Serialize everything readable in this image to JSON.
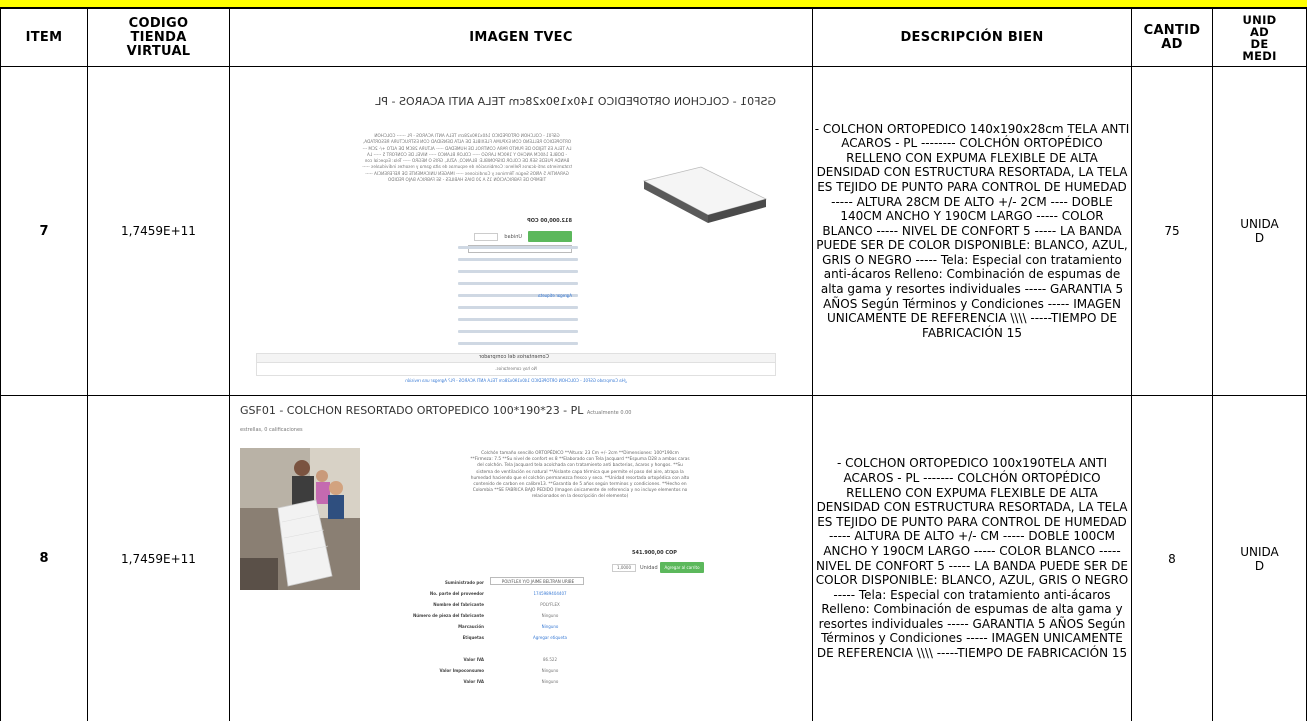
{
  "headers": {
    "item": "ITEM",
    "codigo_line1": "CODIGO",
    "codigo_line2": "TIENDA",
    "codigo_line3": "VIRTUAL",
    "imagen": "IMAGEN TVEC",
    "descripcion": "DESCRIPCIÓN BIEN",
    "cantidad_line1": "CANTID",
    "cantidad_line2": "AD",
    "unidad_line1": "UNID",
    "unidad_line2": "AD",
    "unidad_line3": "DE",
    "unidad_line4": "MEDI"
  },
  "rows": [
    {
      "item": "7",
      "codigo": "1,7459E+11",
      "descripcion": "- COLCHON ORTOPEDICO 140x190x28cm TELA ANTI ACAROS - PL -------- COLCHÓN ORTOPÉDICO RELLENO CON EXPUMA FLEXIBLE DE ALTA DENSIDAD CON ESTRUCTURA RESORTADA, LA TELA ES TEJIDO DE PUNTO PARA CONTROL DE HUMEDAD ----- ALTURA 28CM DE ALTO +/- 2CM ---- DOBLE 140CM ANCHO Y 190CM LARGO ----- COLOR BLANCO ----- NIVEL DE CONFORT 5 ----- LA BANDA PUEDE SER DE COLOR DISPONIBLE: BLANCO, AZUL, GRIS O NEGRO ----- Tela: Especial con tratamiento anti-ácaros Relleno: Combinación de espumas de alta gama y resortes individuales ----- GARANTIA 5 AÑOS Según Términos y Condiciones ----- IMAGEN UNICAMENTE DE REFERENCIA \\\\\\\\ -----TIEMPO DE FABRICACIÓN 15",
      "cantidad": "75",
      "unidad_line1": "UNIDA",
      "unidad_line2": "D",
      "image": {
        "title": "GSF01 - COLCHON ORTOPEDICO 140x190x28cm TELA ANTI ACAROS - PL",
        "price": "812.000,00 COP",
        "unit_label": "Unidad",
        "comments_title": "Comentarios del comprador",
        "comments_body": "No hay comentarios.",
        "footer": "¿Ha Comprado GSF01 - COLCHON ORTOPEDICO 140x190x28cm TELA ANTI ACAROS - PL? Agregar una revisión",
        "tag_label": "Agregar etiqueta"
      }
    },
    {
      "item": "8",
      "codigo": "1,7459E+11",
      "descripcion": "- COLCHON ORTOPEDICO 100x190TELA ANTI ACAROS - PL ------- COLCHÓN ORTOPÉDICO RELLENO CON EXPUMA FLEXIBLE DE ALTA DENSIDAD CON ESTRUCTURA RESORTADA, LA TELA ES TEJIDO DE PUNTO PARA CONTROL DE HUMEDAD ----- ALTURA  DE ALTO +/- CM ----- DOBLE 100CM ANCHO Y 190CM LARGO ----- COLOR BLANCO ----- NIVEL DE CONFORT 5 ----- LA BANDA PUEDE SER DE COLOR DISPONIBLE: BLANCO, AZUL, GRIS O NEGRO ----- Tela: Especial con tratamiento anti-ácaros Relleno: Combinación de espumas de alta gama y resortes individuales ----- GARANTIA 5 AÑOS Según Términos y Condiciones ----- IMAGEN UNICAMENTE DE REFERENCIA \\\\\\\\ -----TIEMPO DE FABRICACIÓN 15",
      "cantidad": "8",
      "unidad_line1": "UNIDA",
      "unidad_line2": "D",
      "image": {
        "title": "GSF01 - COLCHON RESORTADO ORTOPEDICO 100*190*23 - PL",
        "title_small": "Actualmente 0.00",
        "sub": "estrellas, 0 calificaciones",
        "text": "Colchón tamaño sencillo ORTOPÉDICO **Altura: 23 Cm +/- 2cm **Dimensiones: 100*190cm **Firmeza: 7.5 **Su nivel de confort es 8 **Elaborado con Tela Jacquard **Espuma D28 a ambas caras del colchón. Tela Jacquard tela acolchada con tratamiento anti bacterias, ácaros y hongos. **Su sistema de ventilación es natural **Aislante capa térmica que permite el paso del aire, atrapa la humedad haciendo que el colchón permanezca fresco y seco. **Unidad resortada ortopédica con alto contenido de carbon en calibre13. **Garantía de 5 años según terminos y condiciones. **Hecho en Colombia **SE FABRICA BAJO PEDIDO (Imagen únicamente de referencia y no incluye elementos no relacionados en la descripción del elemento)",
        "price": "541.900,00 COP",
        "qty": "1,0000",
        "unit_label": "Unidad",
        "add_button": "Agregar al carrito",
        "labels": [
          "Suministrado por",
          "No. parte del proveedor",
          "Nombre del fabricante",
          "Número de pieza del fabricante",
          "Marcaución",
          "Etiquetas",
          "",
          "Valor IVA",
          "Valor Impoconsumo",
          "Valor IVA"
        ],
        "values": [
          "POLYFLEX Y/O JAIME BELTRAN URIBE",
          "1745989404407",
          "POLYFLEX",
          "Ninguno",
          "Ninguno",
          "Agregar etiqueta",
          "",
          "86.522",
          "Ninguno",
          "Ninguno"
        ]
      }
    }
  ]
}
